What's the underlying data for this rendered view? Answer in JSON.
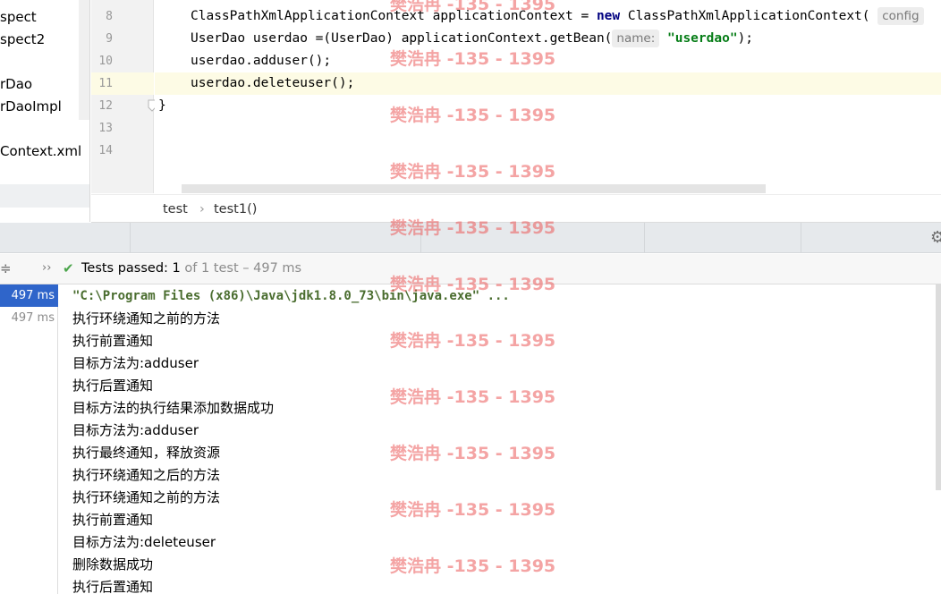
{
  "project_tree": {
    "items": [
      "spect",
      "spect2",
      "rDao",
      "rDaoImpl",
      "Context.xml"
    ]
  },
  "editor": {
    "line_numbers": [
      "8",
      "9",
      "10",
      "11",
      "12",
      "13",
      "14"
    ],
    "line8": {
      "a": "ClassPathXmlApplicationContext applicationContext = ",
      "kw": "new",
      "b": " ClassPathXmlApplicationContext(",
      "hint": "config"
    },
    "line9": {
      "a": "UserDao userdao =(UserDao) applicationContext.getBean(",
      "hint": "name:",
      "str": "\"userdao\"",
      "b": ");"
    },
    "line10": "userdao.adduser();",
    "line11": "userdao.deleteuser();",
    "line12": "}"
  },
  "breadcrumb": {
    "class_name": "test",
    "sep": "›",
    "method": "test1()"
  },
  "toolbar": {
    "collapse_icon": "≑",
    "more_icon": "››",
    "check_icon": "✔",
    "status_label": "Tests passed: ",
    "passed": "1",
    "total_text": " of 1 test – 497 ms"
  },
  "test_tree": {
    "times": [
      "497 ms",
      "497 ms"
    ]
  },
  "console": {
    "command": "\"C:\\Program Files (x86)\\Java\\jdk1.8.0_73\\bin\\java.exe\" ...",
    "lines": [
      "执行环绕通知之前的方法",
      "执行前置通知",
      "目标方法为:adduser",
      "执行后置通知",
      "目标方法的执行结果添加数据成功",
      "目标方法为:adduser",
      "执行最终通知，释放资源",
      "执行环绕通知之后的方法",
      "执行环绕通知之前的方法",
      "执行前置通知",
      "目标方法为:deleteuser",
      "删除数据成功",
      "执行后置通知"
    ]
  },
  "watermark": "樊浩冉 -135 - 1395",
  "colors": {
    "selection": "#2f65ca",
    "keyword": "#000080",
    "string": "#067d17",
    "check": "#4ca54c",
    "watermark": "#eb5a5a"
  },
  "icons": {
    "gear": "gear-icon"
  }
}
